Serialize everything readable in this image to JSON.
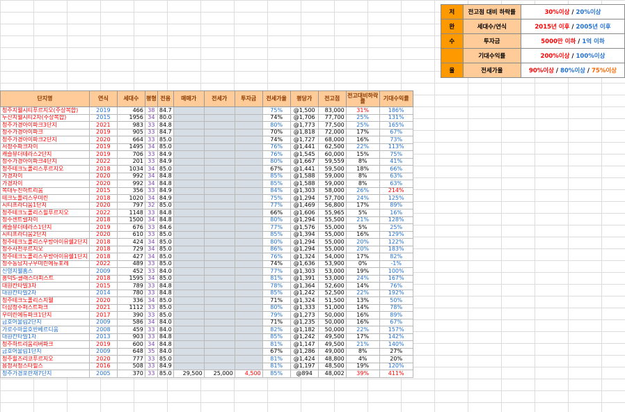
{
  "criteria": {
    "rows": [
      {
        "key": "저",
        "label": "전고점 대비 하락률",
        "value_parts": [
          {
            "t": "30%이상",
            "c": "red"
          },
          {
            "t": " / ",
            "c": ""
          },
          {
            "t": "20%이상",
            "c": "blue"
          }
        ]
      },
      {
        "key": "완",
        "label": "세대수/연식",
        "value_parts": [
          {
            "t": "2015년 이후",
            "c": "red"
          },
          {
            "t": " / ",
            "c": ""
          },
          {
            "t": "2005년 이후",
            "c": "blue"
          }
        ]
      },
      {
        "key": "수",
        "label": "투자금",
        "value_parts": [
          {
            "t": "5000만 이하",
            "c": "red"
          },
          {
            "t": " / ",
            "c": ""
          },
          {
            "t": "1억 이하",
            "c": "blue"
          }
        ]
      },
      {
        "key": "",
        "label": "기대수익률",
        "value_parts": [
          {
            "t": "200%이상",
            "c": "red"
          },
          {
            "t": " / ",
            "c": ""
          },
          {
            "t": "100%이상",
            "c": "blue"
          }
        ]
      },
      {
        "key": "율",
        "label": "전세가율",
        "value_parts": [
          {
            "t": "90%이상",
            "c": "red"
          },
          {
            "t": " / ",
            "c": ""
          },
          {
            "t": "80%이상",
            "c": "blue"
          },
          {
            "t": " / ",
            "c": ""
          },
          {
            "t": "75%이상",
            "c": "orange"
          }
        ]
      }
    ]
  },
  "table": {
    "headers": [
      "단지명",
      "연식",
      "세대수",
      "평형",
      "전용",
      "매매가",
      "전세가",
      "투자금",
      "전세가율",
      "평당가",
      "전고점",
      "전고대비하락률",
      "기대수익률"
    ],
    "rows": [
      [
        "청주지웰시티푸르지오(주상복합)",
        "2019",
        "466",
        "38",
        "84.7",
        "",
        "",
        "",
        "75%",
        "@1,500",
        "83,000",
        "31%",
        "186%"
      ],
      [
        "두산지웰시티2차(주상복합)",
        "2015",
        "1956",
        "34",
        "80.0",
        "",
        "",
        "",
        "74%",
        "@1,706",
        "77,700",
        "25%",
        "131%"
      ],
      [
        "청주가경아이파크3단지",
        "2021",
        "983",
        "33",
        "84.8",
        "",
        "",
        "",
        "80%",
        "@1,773",
        "77,500",
        "25%",
        "165%"
      ],
      [
        "청주가경아이파크",
        "2019",
        "905",
        "33",
        "84.7",
        "",
        "",
        "",
        "70%",
        "@1,818",
        "72,000",
        "17%",
        "67%"
      ],
      [
        "청주가경아이파크2단지",
        "2020",
        "664",
        "33",
        "85.0",
        "",
        "",
        "",
        "74%",
        "@1,727",
        "68,000",
        "16%",
        "73%"
      ],
      [
        "서청주파크자이",
        "2019",
        "1495",
        "34",
        "85.0",
        "",
        "",
        "",
        "76%",
        "@1,441",
        "62,500",
        "22%",
        "113%"
      ],
      [
        "캐슬뷰더테라스2단지",
        "2019",
        "706",
        "33",
        "84.9",
        "",
        "",
        "",
        "76%",
        "@1,545",
        "60,000",
        "15%",
        "75%"
      ],
      [
        "청주가경아이파크4단지",
        "2022",
        "201",
        "33",
        "84.9",
        "",
        "",
        "",
        "80%",
        "@1,667",
        "59,559",
        "8%",
        "41%"
      ],
      [
        "청주테크노폴리스푸르지오",
        "2018",
        "1034",
        "34",
        "85.0",
        "",
        "",
        "",
        "67%",
        "@1,441",
        "59,500",
        "18%",
        "66%"
      ],
      [
        "가경자이",
        "2020",
        "992",
        "34",
        "84.8",
        "",
        "",
        "",
        "85%",
        "@1,588",
        "59,000",
        "8%",
        "63%"
      ],
      [
        "가경자이",
        "2020",
        "992",
        "34",
        "84.8",
        "",
        "",
        "",
        "85%",
        "@1,588",
        "59,000",
        "8%",
        "63%"
      ],
      [
        "복대두진하트리움",
        "2015",
        "356",
        "33",
        "84.9",
        "",
        "",
        "",
        "84%",
        "@1,303",
        "58,000",
        "26%",
        "214%"
      ],
      [
        "테크노폴리스우미린",
        "2018",
        "1020",
        "34",
        "84.9",
        "",
        "",
        "",
        "75%",
        "@1,294",
        "57,700",
        "24%",
        "125%"
      ],
      [
        "시티프라디움1단지",
        "2020",
        "797",
        "32",
        "85.0",
        "",
        "",
        "",
        "77%",
        "@1,469",
        "56,800",
        "17%",
        "89%"
      ],
      [
        "청주테크노폴리스힐푸르지오",
        "2022",
        "1148",
        "33",
        "84.8",
        "",
        "",
        "",
        "66%",
        "@1,606",
        "55,965",
        "5%",
        "16%"
      ],
      [
        "청주센트럴자이",
        "2018",
        "1500",
        "34",
        "84.8",
        "",
        "",
        "",
        "80%",
        "@1,294",
        "55,500",
        "21%",
        "128%"
      ],
      [
        "캐슬뷰더테라스1단지",
        "2019",
        "676",
        "33",
        "84.6",
        "",
        "",
        "",
        "77%",
        "@1,576",
        "55,000",
        "5%",
        "25%"
      ],
      [
        "시티프라디움2단지",
        "2020",
        "610",
        "33",
        "85.0",
        "",
        "",
        "",
        "85%",
        "@1,394",
        "55,000",
        "16%",
        "129%"
      ],
      [
        "청주테크노폴리스우방아이유쉘2단지",
        "2018",
        "424",
        "34",
        "85.0",
        "",
        "",
        "",
        "80%",
        "@1,294",
        "55,000",
        "20%",
        "122%"
      ],
      [
        "청주사천푸르지오",
        "2018",
        "729",
        "34",
        "85.0",
        "",
        "",
        "",
        "86%",
        "@1,294",
        "55,000",
        "20%",
        "183%"
      ],
      [
        "청주테크노폴리스우방아이유쉘1단지",
        "2018",
        "427",
        "34",
        "85.0",
        "",
        "",
        "",
        "76%",
        "@1,324",
        "54,000",
        "17%",
        "82%"
      ],
      [
        "청주동남지구우미린에듀포레",
        "2022",
        "489",
        "33",
        "85.0",
        "",
        "",
        "",
        "74%",
        "@1,636",
        "53,900",
        "0%",
        "-1%"
      ],
      [
        "신영지웰홈스",
        "2009",
        "452",
        "33",
        "84.0",
        "",
        "",
        "",
        "77%",
        "@1,303",
        "53,000",
        "19%",
        "100%"
      ],
      [
        "흥덕S-클래스더피스트",
        "2018",
        "1595",
        "34",
        "85.0",
        "",
        "",
        "",
        "81%",
        "@1,391",
        "53,000",
        "24%",
        "167%"
      ],
      [
        "대원칸타빌3차",
        "2015",
        "789",
        "33",
        "84.8",
        "",
        "",
        "",
        "78%",
        "@1,364",
        "52,600",
        "14%",
        "76%"
      ],
      [
        "대원칸타빌2차",
        "2014",
        "780",
        "33",
        "84.8",
        "",
        "",
        "",
        "85%",
        "@1,242",
        "52,500",
        "22%",
        "192%"
      ],
      [
        "청주테크노폴리스지웰",
        "2020",
        "336",
        "34",
        "85.0",
        "",
        "",
        "",
        "71%",
        "@1,324",
        "51,500",
        "13%",
        "50%"
      ],
      [
        "더샵청주퍼스트파크",
        "2021",
        "1112",
        "33",
        "85.0",
        "",
        "",
        "",
        "80%",
        "@1,333",
        "51,000",
        "14%",
        "78%"
      ],
      [
        "우미린에듀파크1단지",
        "2017",
        "390",
        "33",
        "85.0",
        "",
        "",
        "",
        "79%",
        "@1,273",
        "50,000",
        "16%",
        "89%"
      ],
      [
        "금호어울림2단지",
        "2009",
        "586",
        "34",
        "84.0",
        "",
        "",
        "",
        "71%",
        "@1,235",
        "50,000",
        "16%",
        "67%"
      ],
      [
        "가로수마을호반베르디움",
        "2008",
        "459",
        "33",
        "84.0",
        "",
        "",
        "",
        "82%",
        "@1,182",
        "50,000",
        "22%",
        "157%"
      ],
      [
        "대원칸타빌1차",
        "2013",
        "903",
        "33",
        "84.8",
        "",
        "",
        "",
        "85%",
        "@1,242",
        "49,500",
        "17%",
        "142%"
      ],
      [
        "청주하트리움리버파크",
        "2019",
        "600",
        "34",
        "84.8",
        "",
        "",
        "",
        "81%",
        "@1,147",
        "49,500",
        "21%",
        "140%"
      ],
      [
        "금호어울림1단지",
        "2009",
        "648",
        "35",
        "84.0",
        "",
        "",
        "",
        "67%",
        "@1,286",
        "49,000",
        "8%",
        "27%"
      ],
      [
        "청주힐즈리코푸르지오",
        "2020",
        "777",
        "33",
        "85.0",
        "",
        "",
        "",
        "81%",
        "@1,424",
        "48,800",
        "4%",
        "20%"
      ],
      [
        "용정서청스타힐스",
        "2016",
        "508",
        "33",
        "84.9",
        "",
        "",
        "",
        "81%",
        "@1,197",
        "48,500",
        "19%",
        "120%"
      ],
      [
        "청주가경포란재7단지",
        "2005",
        "370",
        "33",
        "85.0",
        "29,500",
        "25,000",
        "4,500",
        "85%",
        "@894",
        "48,002",
        "39%",
        "411%"
      ]
    ],
    "row_colors": [
      [
        "r",
        "b",
        "",
        "",
        "",
        "",
        "",
        "",
        "b",
        "",
        "",
        "r",
        "b"
      ],
      [
        "r",
        "b",
        "",
        "",
        "",
        "",
        "",
        "",
        "",
        "",
        "",
        "b",
        "b"
      ],
      [
        "r",
        "r",
        "",
        "",
        "",
        "",
        "",
        "",
        "b",
        "",
        "",
        "b",
        "b"
      ],
      [
        "r",
        "r",
        "",
        "",
        "",
        "",
        "",
        "",
        "",
        "",
        "",
        "",
        "b"
      ],
      [
        "r",
        "r",
        "",
        "",
        "",
        "",
        "",
        "",
        "",
        "",
        "",
        "",
        "b"
      ],
      [
        "r",
        "r",
        "",
        "",
        "",
        "",
        "",
        "",
        "b",
        "",
        "",
        "b",
        "b"
      ],
      [
        "r",
        "r",
        "",
        "",
        "",
        "",
        "",
        "",
        "b",
        "",
        "",
        "",
        "b"
      ],
      [
        "r",
        "r",
        "",
        "",
        "",
        "",
        "",
        "",
        "b",
        "",
        "",
        "",
        "b"
      ],
      [
        "r",
        "r",
        "",
        "",
        "",
        "",
        "",
        "",
        "",
        "",
        "",
        "",
        "b"
      ],
      [
        "r",
        "r",
        "",
        "",
        "",
        "",
        "",
        "",
        "b",
        "",
        "",
        "",
        "b"
      ],
      [
        "r",
        "r",
        "",
        "",
        "",
        "",
        "",
        "",
        "b",
        "",
        "",
        "",
        "b"
      ],
      [
        "r",
        "r",
        "",
        "",
        "",
        "",
        "",
        "",
        "b",
        "",
        "",
        "b",
        "r"
      ],
      [
        "r",
        "r",
        "",
        "",
        "",
        "",
        "",
        "",
        "b",
        "",
        "",
        "b",
        "b"
      ],
      [
        "r",
        "r",
        "",
        "",
        "",
        "",
        "",
        "",
        "b",
        "",
        "",
        "",
        "b"
      ],
      [
        "r",
        "r",
        "",
        "",
        "",
        "",
        "",
        "",
        "",
        "",
        "",
        "",
        "b"
      ],
      [
        "r",
        "r",
        "",
        "",
        "",
        "",
        "",
        "",
        "b",
        "",
        "",
        "b",
        "b"
      ],
      [
        "r",
        "r",
        "",
        "",
        "",
        "",
        "",
        "",
        "b",
        "",
        "",
        "",
        "b"
      ],
      [
        "r",
        "r",
        "",
        "",
        "",
        "",
        "",
        "",
        "b",
        "",
        "",
        "",
        "b"
      ],
      [
        "r",
        "r",
        "",
        "",
        "",
        "",
        "",
        "",
        "b",
        "",
        "",
        "b",
        "b"
      ],
      [
        "r",
        "r",
        "",
        "",
        "",
        "",
        "",
        "",
        "b",
        "",
        "",
        "b",
        "b"
      ],
      [
        "r",
        "r",
        "",
        "",
        "",
        "",
        "",
        "",
        "b",
        "",
        "",
        "",
        "b"
      ],
      [
        "r",
        "r",
        "",
        "",
        "",
        "",
        "",
        "",
        "",
        "",
        "",
        "",
        "b"
      ],
      [
        "b",
        "b",
        "",
        "",
        "",
        "",
        "",
        "",
        "b",
        "",
        "",
        "",
        "b"
      ],
      [
        "r",
        "r",
        "",
        "",
        "",
        "",
        "",
        "",
        "b",
        "",
        "",
        "b",
        "b"
      ],
      [
        "r",
        "r",
        "",
        "",
        "",
        "",
        "",
        "",
        "b",
        "",
        "",
        "",
        "b"
      ],
      [
        "b",
        "b",
        "",
        "",
        "",
        "",
        "",
        "",
        "b",
        "",
        "",
        "b",
        "b"
      ],
      [
        "r",
        "r",
        "",
        "",
        "",
        "",
        "",
        "",
        "",
        "",
        "",
        "",
        "b"
      ],
      [
        "r",
        "r",
        "",
        "",
        "",
        "",
        "",
        "",
        "b",
        "",
        "",
        "",
        "b"
      ],
      [
        "r",
        "r",
        "",
        "",
        "",
        "",
        "",
        "",
        "b",
        "",
        "",
        "",
        "b"
      ],
      [
        "b",
        "b",
        "",
        "",
        "",
        "",
        "",
        "",
        "",
        "",
        "",
        "",
        "b"
      ],
      [
        "b",
        "b",
        "",
        "",
        "",
        "",
        "",
        "",
        "b",
        "",
        "",
        "b",
        "b"
      ],
      [
        "b",
        "b",
        "",
        "",
        "",
        "",
        "",
        "",
        "b",
        "",
        "",
        "",
        "b"
      ],
      [
        "r",
        "r",
        "",
        "",
        "",
        "",
        "",
        "",
        "b",
        "",
        "",
        "b",
        "b"
      ],
      [
        "b",
        "b",
        "",
        "",
        "",
        "",
        "",
        "",
        "",
        "",
        "",
        "",
        ""
      ],
      [
        "r",
        "r",
        "",
        "",
        "",
        "",
        "",
        "",
        "b",
        "",
        "",
        "",
        ""
      ],
      [
        "r",
        "r",
        "",
        "",
        "",
        "",
        "",
        "",
        "b",
        "",
        "",
        "",
        "b"
      ],
      [
        "b",
        "b",
        "",
        "",
        "",
        "",
        "",
        "r",
        "b",
        "",
        "",
        "r",
        "r"
      ]
    ]
  },
  "colors": {
    "red": "#ff0000",
    "blue": "#1f6fd1",
    "header_bg": "#ffcc99",
    "key_bg": "#ff9900"
  }
}
